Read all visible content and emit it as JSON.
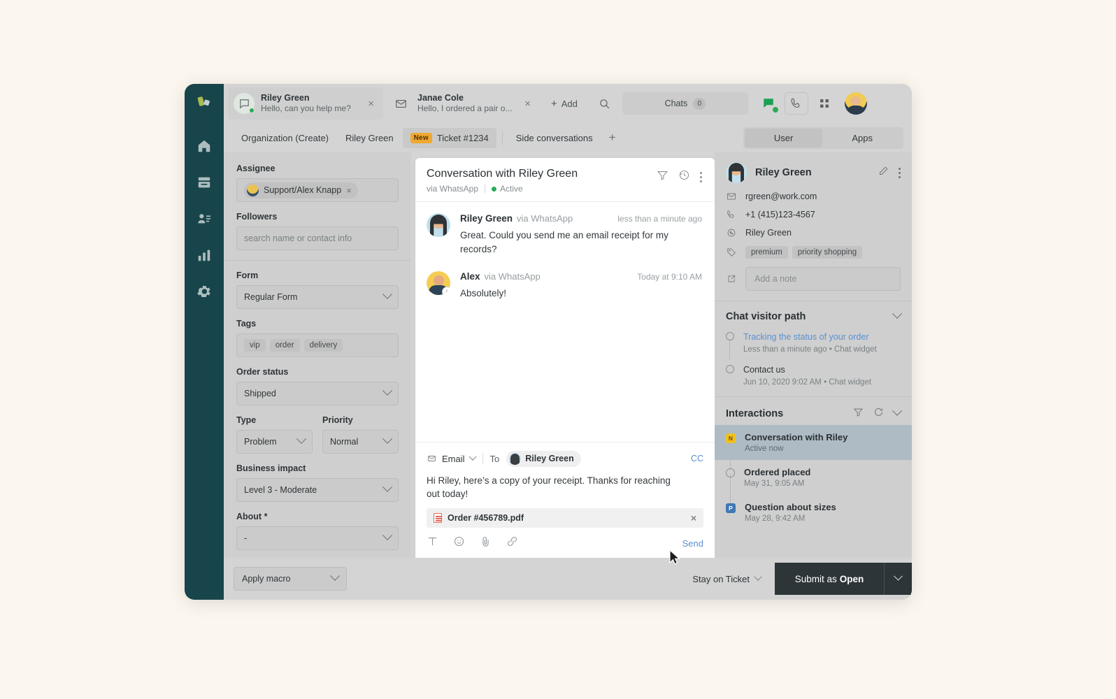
{
  "rail": {
    "items": [
      {
        "name": "logo",
        "icon": "logo-icon"
      },
      {
        "name": "home",
        "icon": "home-icon"
      },
      {
        "name": "views",
        "icon": "inbox-icon"
      },
      {
        "name": "contacts",
        "icon": "contacts-icon"
      },
      {
        "name": "reporting",
        "icon": "bar-chart-icon"
      },
      {
        "name": "settings",
        "icon": "gear-icon"
      }
    ]
  },
  "topbar": {
    "tabs": [
      {
        "title": "Riley Green",
        "subtitle": "Hello, can you help me?",
        "icon": "chat-bubble-icon",
        "status": "online",
        "active": true,
        "close": "×"
      },
      {
        "title": "Janae Cole",
        "subtitle": "Hello, I ordered a pair o...",
        "icon": "envelope-icon",
        "status": "",
        "active": false,
        "close": "×"
      }
    ],
    "add_label": "Add",
    "add_plus": "+",
    "search_icon": "search-icon",
    "chats_label": "Chats",
    "chats_count": "0",
    "chat_icon": "chat-green-icon",
    "phone_icon": "phone-icon",
    "apps_grid_icon": "grid-icon",
    "avatar": "user-avatar"
  },
  "crumbbar": {
    "items": [
      {
        "label": "Organization (Create)",
        "selected": false,
        "badge": ""
      },
      {
        "label": "Riley Green",
        "selected": false,
        "badge": ""
      },
      {
        "label": "Ticket #1234",
        "selected": true,
        "badge": "New"
      }
    ],
    "side_conversations": "Side conversations",
    "side_plus": "+",
    "segments": [
      {
        "label": "User",
        "active": true
      },
      {
        "label": "Apps",
        "active": false
      }
    ]
  },
  "properties": {
    "assignee": {
      "label": "Assignee",
      "chip": "Support/Alex Knapp",
      "chip_close": "×"
    },
    "followers": {
      "label": "Followers",
      "placeholder": "search name or contact info"
    },
    "form": {
      "label": "Form",
      "value": "Regular Form"
    },
    "tags": {
      "label": "Tags",
      "items": [
        "vip",
        "order",
        "delivery"
      ]
    },
    "order_status": {
      "label": "Order status",
      "value": "Shipped"
    },
    "type": {
      "label": "Type",
      "value": "Problem"
    },
    "priority": {
      "label": "Priority",
      "value": "Normal"
    },
    "business_impact": {
      "label": "Business impact",
      "value": "Level 3 - Moderate"
    },
    "about": {
      "label": "About *",
      "value": "-"
    }
  },
  "conversation": {
    "title": "Conversation with Riley Green",
    "channel": "via WhatsApp",
    "status": "Active",
    "header_icons": [
      "filter-icon",
      "history-icon",
      "kebab-icon"
    ],
    "messages": [
      {
        "author": "Riley Green",
        "via": "via WhatsApp",
        "time": "less than a minute ago",
        "text": "Great. Could you send me an email receipt for my records?",
        "avatar": "riley-avatar",
        "is_agent": false
      },
      {
        "author": "Alex",
        "via": "via WhatsApp",
        "time": "Today at 9:10 AM",
        "text": "Absolutely!",
        "avatar": "alex-avatar",
        "is_agent": true
      }
    ]
  },
  "composer": {
    "channel": "Email",
    "to_label": "To",
    "to_recipient": "Riley Green",
    "cc_label": "CC",
    "body": "Hi Riley, here’s a copy of your receipt. Thanks for reaching out today!",
    "attachment": {
      "name": "Order #456789.pdf",
      "remove": "×"
    },
    "tools": [
      "text-format-icon",
      "emoji-icon",
      "attachment-icon",
      "link-icon"
    ],
    "send_label": "Send"
  },
  "right_panel": {
    "contact": {
      "name": "Riley Green",
      "edit_icon": "pencil-icon",
      "kebab_icon": "kebab-icon",
      "email": "rgreen@work.com",
      "phone": "+1 (415)123-4567",
      "whatsapp": "Riley Green",
      "tags": [
        "premium",
        "priority shopping"
      ],
      "note_placeholder": "Add a note"
    },
    "visitor_path": {
      "title": "Chat visitor path",
      "collapse_icon": "chevron-down-icon",
      "items": [
        {
          "title": "Tracking the status of your order",
          "meta": "Less than a minute ago • Chat widget",
          "is_link": true
        },
        {
          "title": "Contact us",
          "meta": "Jun 10, 2020 9:02 AM • Chat widget",
          "is_link": false
        }
      ]
    },
    "interactions": {
      "title": "Interactions",
      "icons": [
        "filter-icon",
        "refresh-icon",
        "chevron-down-icon"
      ],
      "items": [
        {
          "title": "Conversation with Riley",
          "meta": "Active now",
          "marker": "N",
          "marker_color": "yellow",
          "selected": true
        },
        {
          "title": "Ordered placed",
          "meta": "May 31, 9:05 AM",
          "marker": "",
          "marker_color": "circle",
          "selected": false
        },
        {
          "title": "Question about sizes",
          "meta": "May 28, 9:42 AM",
          "marker": "P",
          "marker_color": "blue",
          "selected": false
        }
      ]
    }
  },
  "bottom": {
    "macro_label": "Apply macro",
    "stay_label": "Stay on Ticket",
    "submit_prefix": "Submit as",
    "submit_state": "Open"
  },
  "colors": {
    "rail_bg": "#17454b",
    "accent_link": "#5b8fd0",
    "status_green": "#2aab54",
    "badge_new": "#f0a830",
    "submit_dark": "#2d3538",
    "page_bg": "#fbf6ee"
  }
}
